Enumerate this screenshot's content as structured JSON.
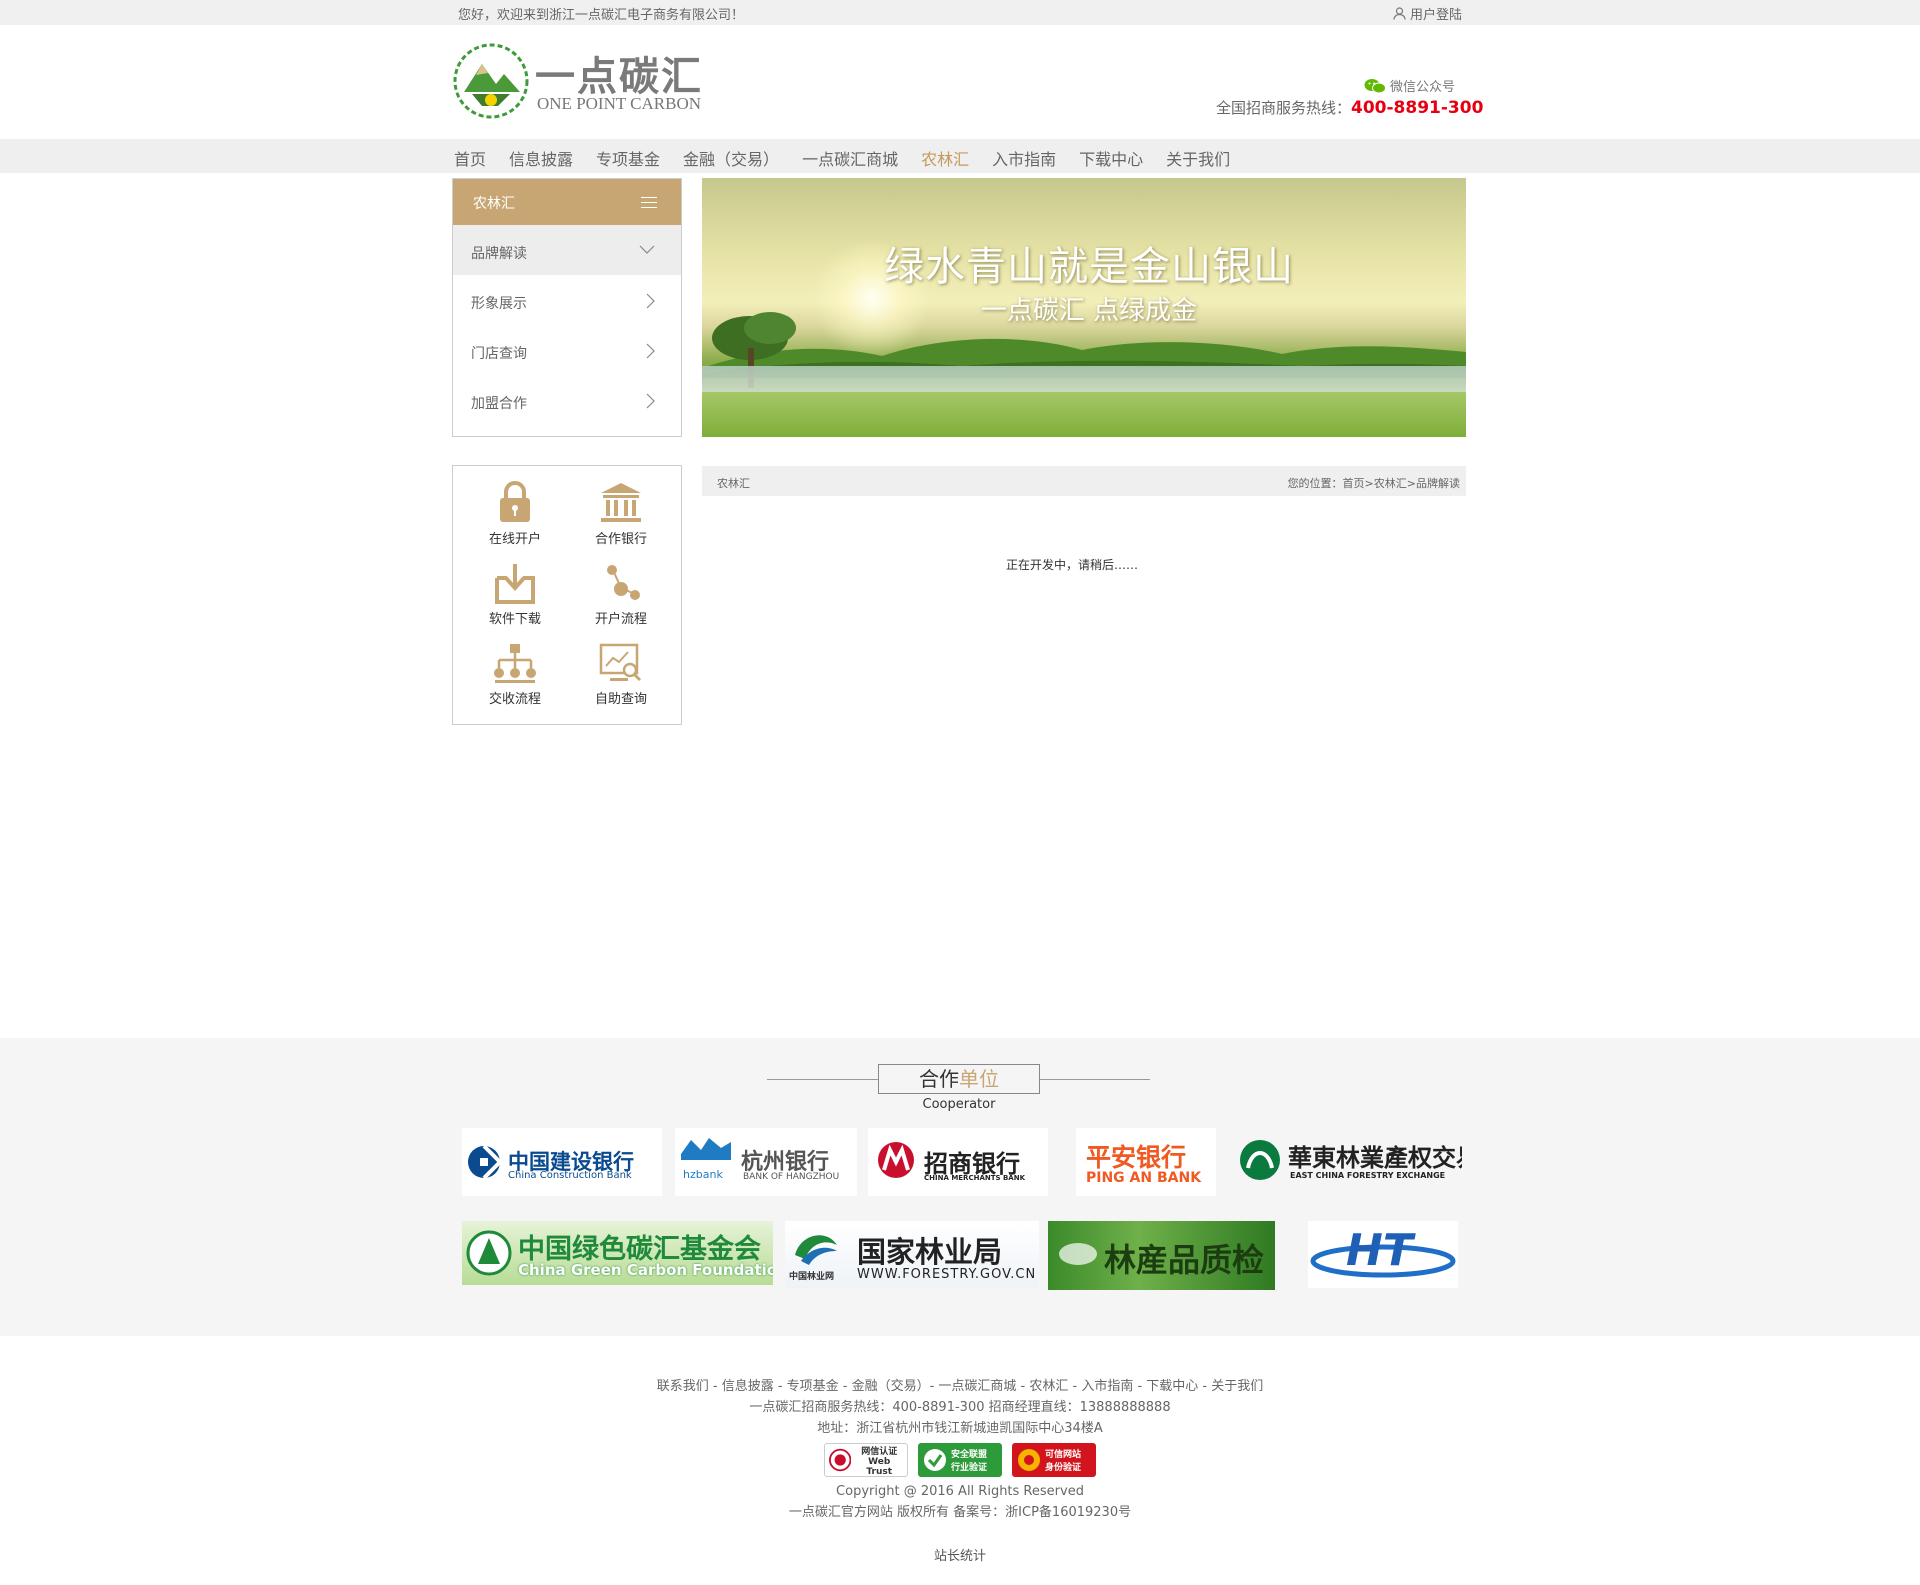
{
  "topbar": {
    "welcome": "您好，欢迎来到浙江一点碳汇电子商务有限公司！",
    "login": "用户登陆"
  },
  "header": {
    "logo_cn": "一点碳汇",
    "logo_en": "ONE POINT CARBON",
    "wechat": "微信公众号",
    "hotline_label": "全国招商服务热线：",
    "hotline_number": "400-8891-300"
  },
  "nav": {
    "items": [
      {
        "label": "首页"
      },
      {
        "label": "信息披露"
      },
      {
        "label": "专项基金"
      },
      {
        "label": "金融（交易）"
      },
      {
        "label": "一点碳汇商城"
      },
      {
        "label": "农林汇"
      },
      {
        "label": "入市指南"
      },
      {
        "label": "下载中心"
      },
      {
        "label": "关于我们"
      }
    ],
    "active": "农林汇"
  },
  "sidemenu": {
    "title": "农林汇",
    "items": [
      {
        "label": "品牌解读"
      },
      {
        "label": "形象展示"
      },
      {
        "label": "门店查询"
      },
      {
        "label": "加盟合作"
      }
    ]
  },
  "banner": {
    "line1": "绿水青山就是金山银山",
    "line2": "一点碳汇 点绿成金"
  },
  "quick": {
    "items": [
      {
        "label": "在线开户",
        "icon": "lock-icon"
      },
      {
        "label": "合作银行",
        "icon": "bank-icon"
      },
      {
        "label": "软件下载",
        "icon": "download-icon"
      },
      {
        "label": "开户流程",
        "icon": "flow-icon"
      },
      {
        "label": "交收流程",
        "icon": "org-chart-icon"
      },
      {
        "label": "自助查询",
        "icon": "search-screen-icon"
      }
    ]
  },
  "content": {
    "crumb_left": "农林汇",
    "crumb_right": "您的位置：首页>农林汇>品牌解读",
    "message": "正在开发中，请稍后……"
  },
  "cooperator": {
    "title_a": "合作",
    "title_b": "单位",
    "subtitle": "Cooperator",
    "logos": [
      {
        "cn": "中国建设银行",
        "en": "China Construction Bank"
      },
      {
        "cn": "杭州银行",
        "en": "BANK OF HANGZHOU",
        "tag": "hzbank"
      },
      {
        "cn": "招商银行",
        "en": "CHINA MERCHANTS BANK"
      },
      {
        "cn": "平安银行",
        "en": "PING AN BANK"
      },
      {
        "cn": "華東林業產权交易所",
        "en": "EAST CHINA FORESTRY EXCHANGE"
      },
      {
        "cn": "中国绿色碳汇基金会",
        "en": "China Green Carbon Foundation"
      },
      {
        "cn": "国家林业局",
        "en": "WWW.FORESTRY.GOV.CN",
        "tag": "中国林业网"
      },
      {
        "cn": "林産品质检",
        "en": ""
      },
      {
        "cn": "HT",
        "en": ""
      }
    ]
  },
  "footer": {
    "links": "联系我们 - 信息披露 - 专项基金 - 金融（交易）- 一点碳汇商城 - 农林汇 - 入市指南 - 下载中心 - 关于我们",
    "phones": "一点碳汇招商服务热线：400-8891-300   招商经理直线：13888888888",
    "address": "地址：浙江省杭州市钱江新城迪凯国际中心34楼A",
    "badges": [
      {
        "line1": "网信认证",
        "line2": "Web Trust"
      },
      {
        "line1": "安全联盟",
        "line2": "行业验证"
      },
      {
        "line1": "可信网站",
        "line2": "身份验证"
      }
    ],
    "copyright": "Copyright @ 2016 All Rights Reserved",
    "icp": "一点碳汇官方网站 版权所有 备案号：浙ICP备16019230号",
    "stat": "站长统计"
  }
}
